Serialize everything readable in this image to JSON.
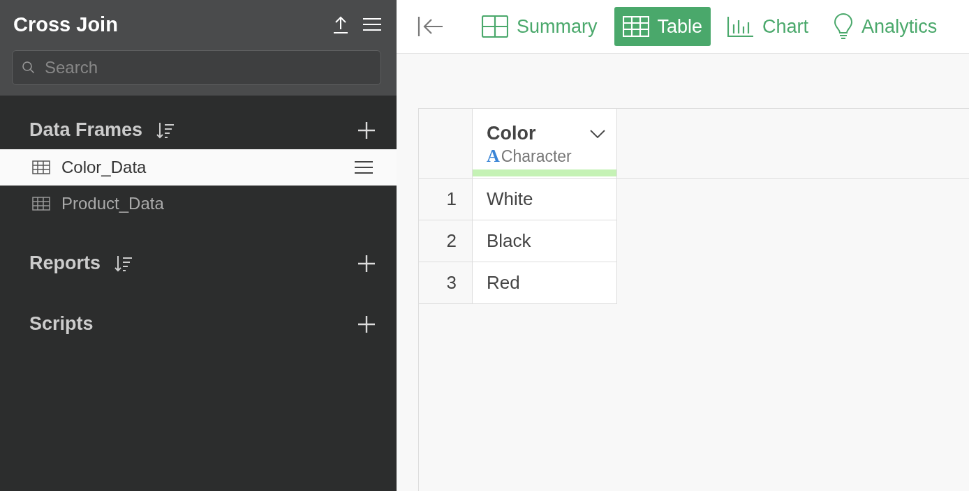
{
  "sidebar": {
    "title": "Cross Join",
    "search": {
      "placeholder": "Search"
    },
    "sections": [
      {
        "title": "Data Frames",
        "sortable": true,
        "items": [
          {
            "name": "Color_Data",
            "selected": true
          },
          {
            "name": "Product_Data",
            "selected": false
          }
        ]
      },
      {
        "title": "Reports",
        "sortable": true
      },
      {
        "title": "Scripts",
        "sortable": false
      }
    ]
  },
  "toolbar": {
    "tabs": [
      {
        "label": "Summary",
        "kind": "summary",
        "selected": false
      },
      {
        "label": "Table",
        "kind": "table",
        "selected": true
      },
      {
        "label": "Chart",
        "kind": "chart",
        "selected": false
      },
      {
        "label": "Analytics",
        "kind": "analytics",
        "selected": false
      }
    ]
  },
  "table": {
    "columns": [
      {
        "name": "Color",
        "type": "Character",
        "type_glyph": "A"
      }
    ],
    "rows": [
      {
        "number": "1",
        "cells": [
          "White"
        ]
      },
      {
        "number": "2",
        "cells": [
          "Black"
        ]
      },
      {
        "number": "3",
        "cells": [
          "Red"
        ]
      }
    ]
  }
}
